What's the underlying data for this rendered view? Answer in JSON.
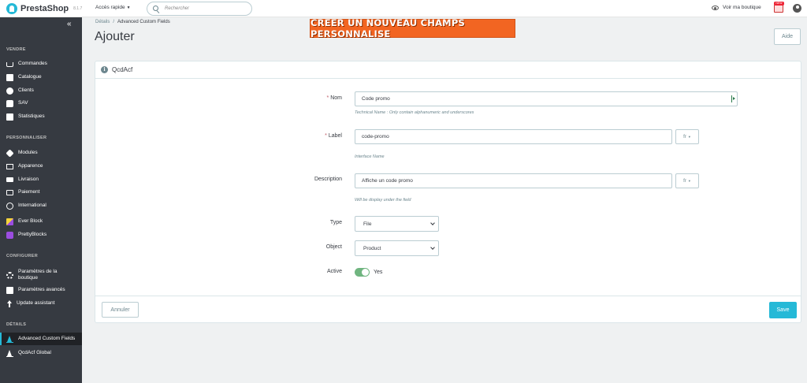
{
  "topbar": {
    "brand": "PrestaShop",
    "version": "8.1.7",
    "quick_access": "Accès rapide",
    "search_placeholder": "Rechercher",
    "view_shop": "Voir ma boutique",
    "notif_badge": "NEW"
  },
  "sidebar": {
    "collapse_icon": "«",
    "sections": [
      {
        "title": "VENDRE",
        "items": [
          {
            "label": "Commandes",
            "icon": "cart-icon"
          },
          {
            "label": "Catalogue",
            "icon": "catalog-icon"
          },
          {
            "label": "Clients",
            "icon": "user-icon"
          },
          {
            "label": "SAV",
            "icon": "chat-icon"
          },
          {
            "label": "Statistiques",
            "icon": "stats-icon"
          }
        ]
      },
      {
        "title": "PERSONNALISER",
        "items": [
          {
            "label": "Modules",
            "icon": "puzzle-icon"
          },
          {
            "label": "Apparence",
            "icon": "monitor-icon"
          },
          {
            "label": "Livraison",
            "icon": "truck-icon"
          },
          {
            "label": "Paiement",
            "icon": "card-icon"
          },
          {
            "label": "International",
            "icon": "globe-icon"
          },
          {
            "label": "Ever Block",
            "icon": "everblock-icon"
          },
          {
            "label": "PrettyBlocks",
            "icon": "prettyblocks-icon"
          }
        ]
      },
      {
        "title": "CONFIGURER",
        "items": [
          {
            "label": "Paramètres de la boutique",
            "icon": "gear-icon"
          },
          {
            "label": "Paramètres avancés",
            "icon": "settings-icon"
          },
          {
            "label": "Update assistant",
            "icon": "upload-arrow-icon"
          }
        ]
      },
      {
        "title": "DÉTAILS",
        "items": [
          {
            "label": "Advanced Custom Fields",
            "icon": "acf-icon",
            "active": true
          },
          {
            "label": "QcdAcf Global",
            "icon": "acf-icon"
          }
        ]
      }
    ]
  },
  "breadcrumb": {
    "parent": "Détails",
    "separator": "/",
    "current": "Advanced Custom Fields"
  },
  "page_title": "Ajouter",
  "banner": "CREER UN NOUVEAU CHAMPS PERSONNALISE",
  "help_button": "Aide",
  "panel": {
    "title": "QcdAcf",
    "fields": {
      "nom": {
        "label": "Nom",
        "required": "*",
        "value": "Code promo",
        "hint": "Technical Name : Only contain alphanumeric and underscores"
      },
      "label": {
        "label": "Label",
        "required": "*",
        "value": "code-promo",
        "lang": "fr",
        "hint": "Interface Name"
      },
      "description": {
        "label": "Description",
        "value": "Affiche un code promo",
        "lang": "fr",
        "hint": "Will be display under the field"
      },
      "type": {
        "label": "Type",
        "value": "File"
      },
      "object": {
        "label": "Object",
        "value": "Product"
      },
      "active": {
        "label": "Active",
        "value": "Yes",
        "on": true
      }
    },
    "cancel_label": "Annuler",
    "save_label": "Save"
  },
  "colors": {
    "accent": "#25b9d7",
    "sidebar_bg": "#363a41",
    "banner": "#f26522",
    "toggle_on": "#70b580"
  }
}
